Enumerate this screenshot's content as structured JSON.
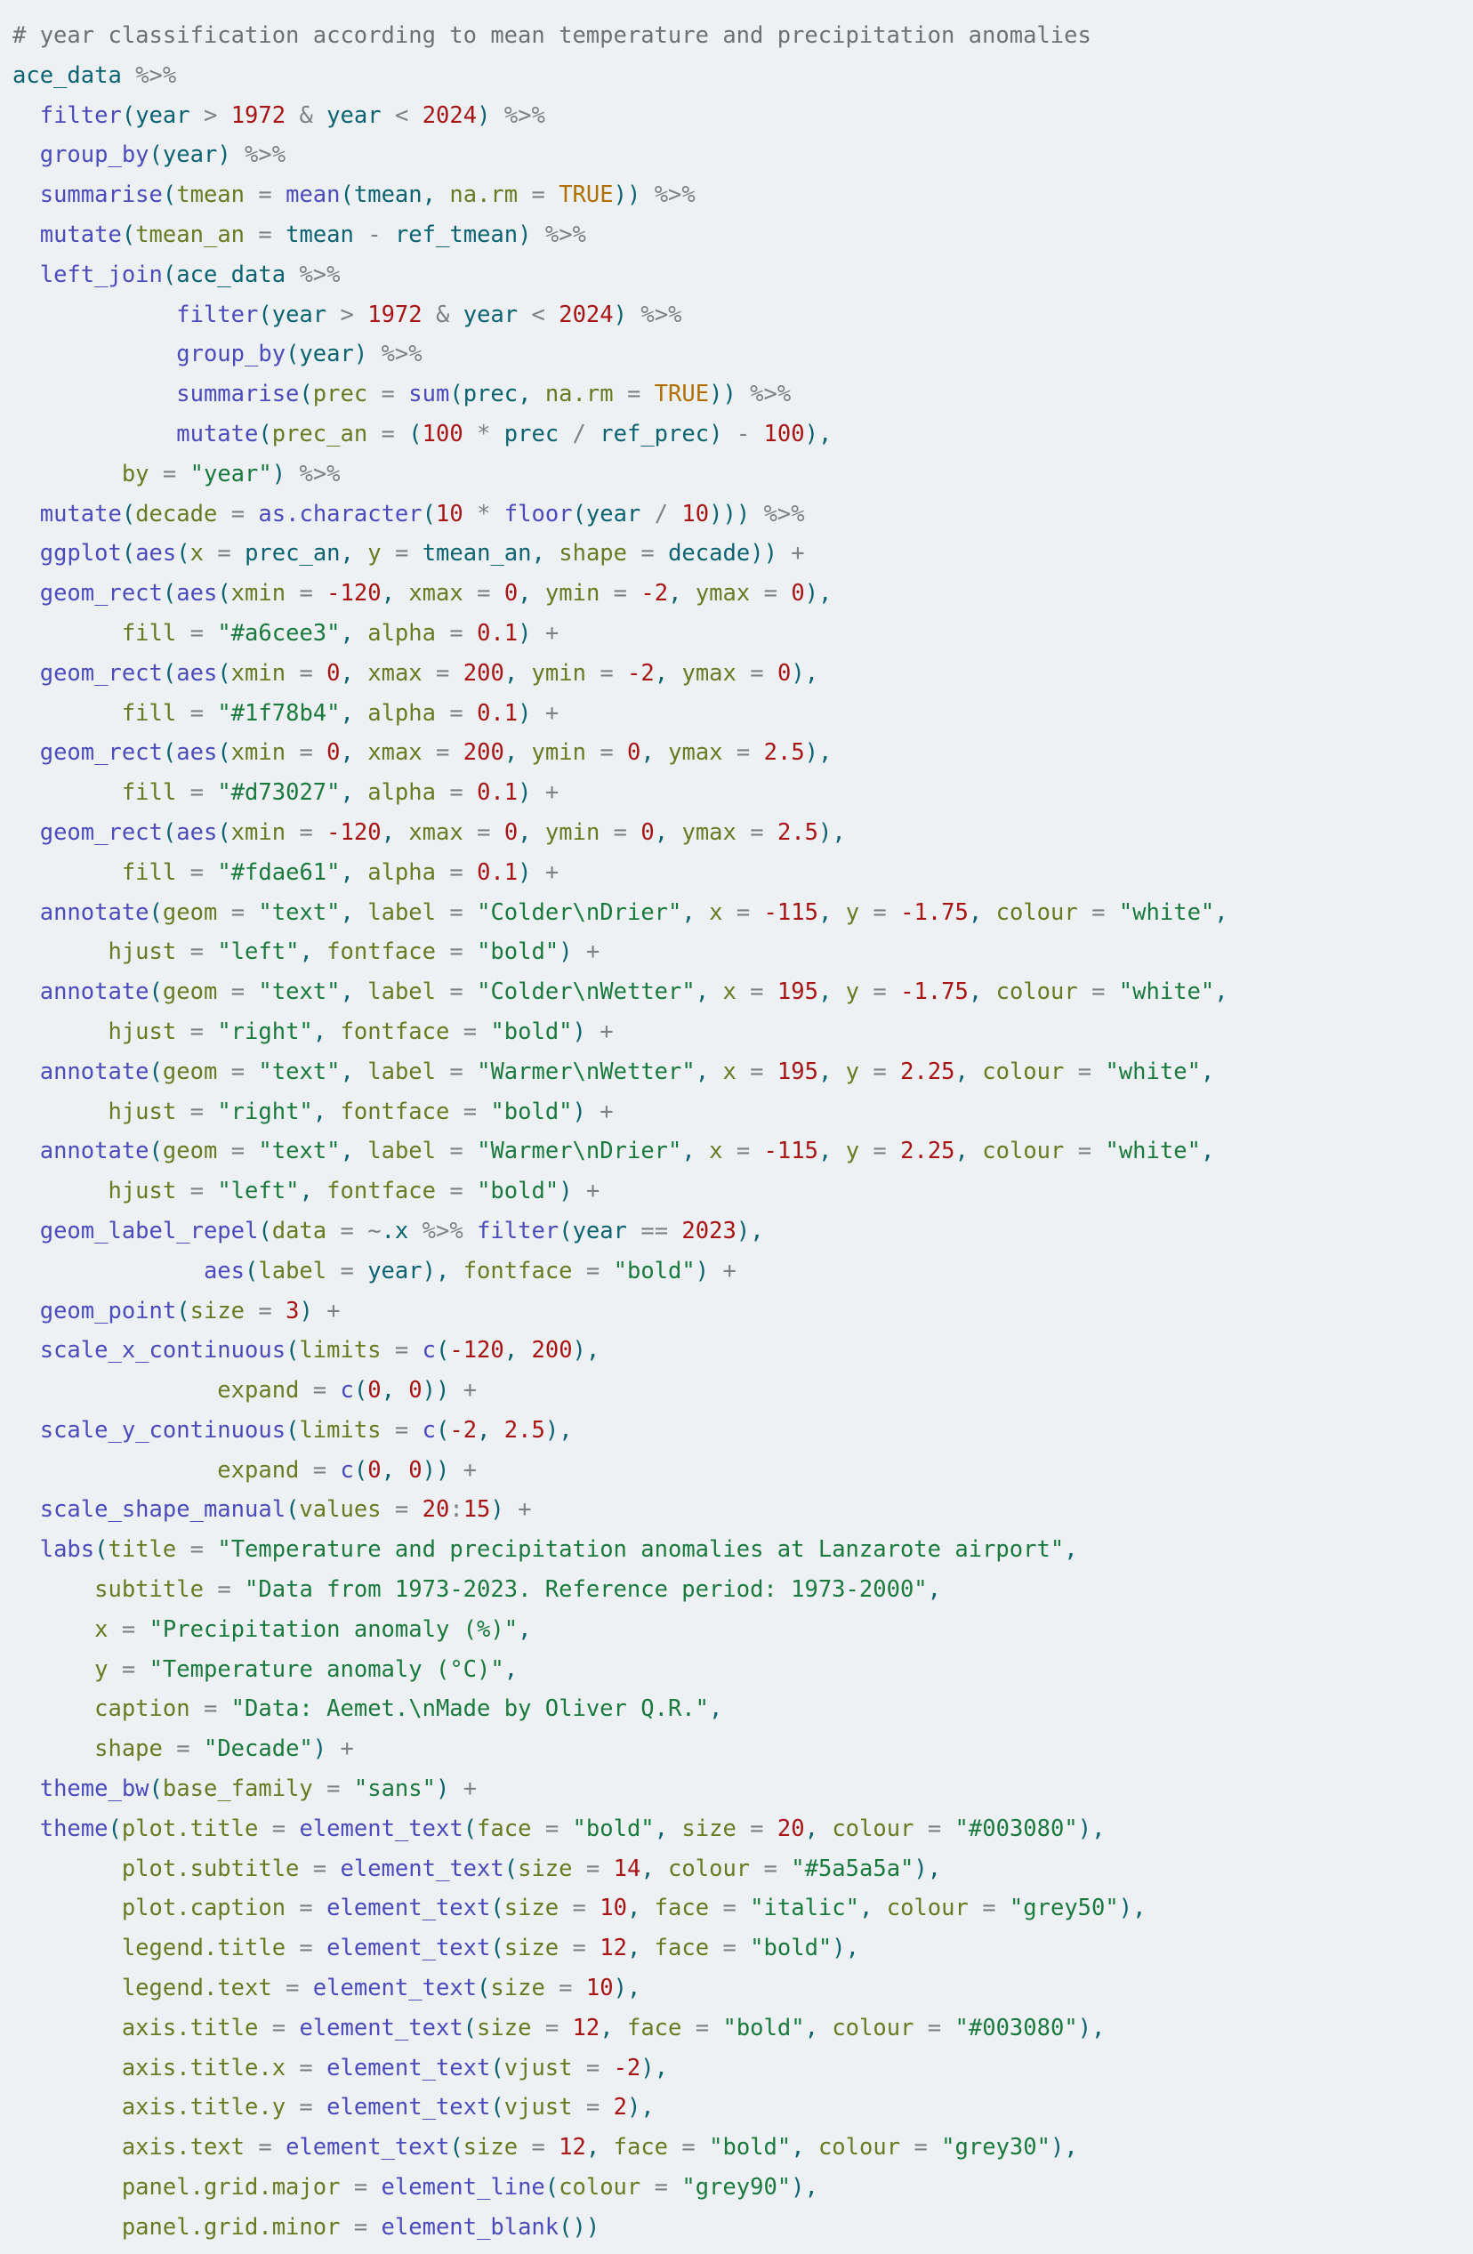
{
  "editor": {
    "language": "R",
    "background": "#eef1f4",
    "default_text_color": "#333333",
    "theme_colors": {
      "comment": "#707070",
      "identifier": "#0b6371",
      "function": "#4b4bbd",
      "punctuation": "#0b6371",
      "operator": "#808080",
      "argument": "#6b7a22",
      "number": "#a81414",
      "string": "#1a7a3e",
      "constant": "#b07000",
      "pipe": "#808080"
    }
  },
  "code": {
    "lines": [
      {
        "n": 1,
        "indent": 0,
        "text": "# year classification according to mean temperature and precipitation anomalies"
      },
      {
        "n": 2,
        "indent": 0,
        "text": "ace_data %>%"
      },
      {
        "n": 3,
        "indent": 2,
        "text": "filter(year > 1972 & year < 2024) %>%"
      },
      {
        "n": 4,
        "indent": 2,
        "text": "group_by(year) %>%"
      },
      {
        "n": 5,
        "indent": 2,
        "text": "summarise(tmean = mean(tmean, na.rm = TRUE)) %>%"
      },
      {
        "n": 6,
        "indent": 2,
        "text": "mutate(tmean_an = tmean - ref_tmean) %>%"
      },
      {
        "n": 7,
        "indent": 2,
        "text": "left_join(ace_data %>%"
      },
      {
        "n": 8,
        "indent": 12,
        "text": "filter(year > 1972 & year < 2024) %>%"
      },
      {
        "n": 9,
        "indent": 12,
        "text": "group_by(year) %>%"
      },
      {
        "n": 10,
        "indent": 12,
        "text": "summarise(prec = sum(prec, na.rm = TRUE)) %>%"
      },
      {
        "n": 11,
        "indent": 12,
        "text": "mutate(prec_an = (100 * prec / ref_prec) - 100),"
      },
      {
        "n": 12,
        "indent": 8,
        "text": "by = \"year\") %>%"
      },
      {
        "n": 13,
        "indent": 2,
        "text": "mutate(decade = as.character(10 * floor(year / 10))) %>%"
      },
      {
        "n": 14,
        "indent": 2,
        "text": "ggplot(aes(x = prec_an, y = tmean_an, shape = decade)) +"
      },
      {
        "n": 15,
        "indent": 2,
        "text": "geom_rect(aes(xmin = -120, xmax = 0, ymin = -2, ymax = 0),"
      },
      {
        "n": 16,
        "indent": 8,
        "text": "fill = \"#a6cee3\", alpha = 0.1) +"
      },
      {
        "n": 17,
        "indent": 2,
        "text": "geom_rect(aes(xmin = 0, xmax = 200, ymin = -2, ymax = 0),"
      },
      {
        "n": 18,
        "indent": 8,
        "text": "fill = \"#1f78b4\", alpha = 0.1) +"
      },
      {
        "n": 19,
        "indent": 2,
        "text": "geom_rect(aes(xmin = 0, xmax = 200, ymin = 0, ymax = 2.5),"
      },
      {
        "n": 20,
        "indent": 8,
        "text": "fill = \"#d73027\", alpha = 0.1) +"
      },
      {
        "n": 21,
        "indent": 2,
        "text": "geom_rect(aes(xmin = -120, xmax = 0, ymin = 0, ymax = 2.5),"
      },
      {
        "n": 22,
        "indent": 8,
        "text": "fill = \"#fdae61\", alpha = 0.1) +"
      },
      {
        "n": 23,
        "indent": 2,
        "text": "annotate(geom = \"text\", label = \"Colder\\nDrier\", x = -115, y = -1.75, colour = \"white\","
      },
      {
        "n": 24,
        "indent": 7,
        "text": "hjust = \"left\", fontface = \"bold\") +"
      },
      {
        "n": 25,
        "indent": 2,
        "text": "annotate(geom = \"text\", label = \"Colder\\nWetter\", x = 195, y = -1.75, colour = \"white\","
      },
      {
        "n": 26,
        "indent": 7,
        "text": "hjust = \"right\", fontface = \"bold\") +"
      },
      {
        "n": 27,
        "indent": 2,
        "text": "annotate(geom = \"text\", label = \"Warmer\\nWetter\", x = 195, y = 2.25, colour = \"white\","
      },
      {
        "n": 28,
        "indent": 7,
        "text": "hjust = \"right\", fontface = \"bold\") +"
      },
      {
        "n": 29,
        "indent": 2,
        "text": "annotate(geom = \"text\", label = \"Warmer\\nDrier\", x = -115, y = 2.25, colour = \"white\","
      },
      {
        "n": 30,
        "indent": 7,
        "text": "hjust = \"left\", fontface = \"bold\") +"
      },
      {
        "n": 31,
        "indent": 2,
        "text": "geom_label_repel(data = ~.x %>% filter(year == 2023),"
      },
      {
        "n": 32,
        "indent": 14,
        "text": "aes(label = year), fontface = \"bold\") +"
      },
      {
        "n": 33,
        "indent": 2,
        "text": "geom_point(size = 3) +"
      },
      {
        "n": 34,
        "indent": 2,
        "text": "scale_x_continuous(limits = c(-120, 200),"
      },
      {
        "n": 35,
        "indent": 15,
        "text": "expand = c(0, 0)) +"
      },
      {
        "n": 36,
        "indent": 2,
        "text": "scale_y_continuous(limits = c(-2, 2.5),"
      },
      {
        "n": 37,
        "indent": 15,
        "text": "expand = c(0, 0)) +"
      },
      {
        "n": 38,
        "indent": 2,
        "text": "scale_shape_manual(values = 20:15) +"
      },
      {
        "n": 39,
        "indent": 2,
        "text": "labs(title = \"Temperature and precipitation anomalies at Lanzarote airport\","
      },
      {
        "n": 40,
        "indent": 6,
        "text": "subtitle = \"Data from 1973-2023. Reference period: 1973-2000\","
      },
      {
        "n": 41,
        "indent": 6,
        "text": "x = \"Precipitation anomaly (%)\","
      },
      {
        "n": 42,
        "indent": 6,
        "text": "y = \"Temperature anomaly (°C)\","
      },
      {
        "n": 43,
        "indent": 6,
        "text": "caption = \"Data: Aemet.\\nMade by Oliver Q.R.\","
      },
      {
        "n": 44,
        "indent": 6,
        "text": "shape = \"Decade\") +"
      },
      {
        "n": 45,
        "indent": 2,
        "text": "theme_bw(base_family = \"sans\") +"
      },
      {
        "n": 46,
        "indent": 2,
        "text": "theme(plot.title = element_text(face = \"bold\", size = 20, colour = \"#003080\"),"
      },
      {
        "n": 47,
        "indent": 8,
        "text": "plot.subtitle = element_text(size = 14, colour = \"#5a5a5a\"),"
      },
      {
        "n": 48,
        "indent": 8,
        "text": "plot.caption = element_text(size = 10, face = \"italic\", colour = \"grey50\"),"
      },
      {
        "n": 49,
        "indent": 8,
        "text": "legend.title = element_text(size = 12, face = \"bold\"),"
      },
      {
        "n": 50,
        "indent": 8,
        "text": "legend.text = element_text(size = 10),"
      },
      {
        "n": 51,
        "indent": 8,
        "text": "axis.title = element_text(size = 12, face = \"bold\", colour = \"#003080\"),"
      },
      {
        "n": 52,
        "indent": 8,
        "text": "axis.title.x = element_text(vjust = -2),"
      },
      {
        "n": 53,
        "indent": 8,
        "text": "axis.title.y = element_text(vjust = 2),"
      },
      {
        "n": 54,
        "indent": 8,
        "text": "axis.text = element_text(size = 12, face = \"bold\", colour = \"grey30\"),"
      },
      {
        "n": 55,
        "indent": 8,
        "text": "panel.grid.major = element_line(colour = \"grey90\"),"
      },
      {
        "n": 56,
        "indent": 8,
        "text": "panel.grid.minor = element_blank())"
      }
    ]
  }
}
